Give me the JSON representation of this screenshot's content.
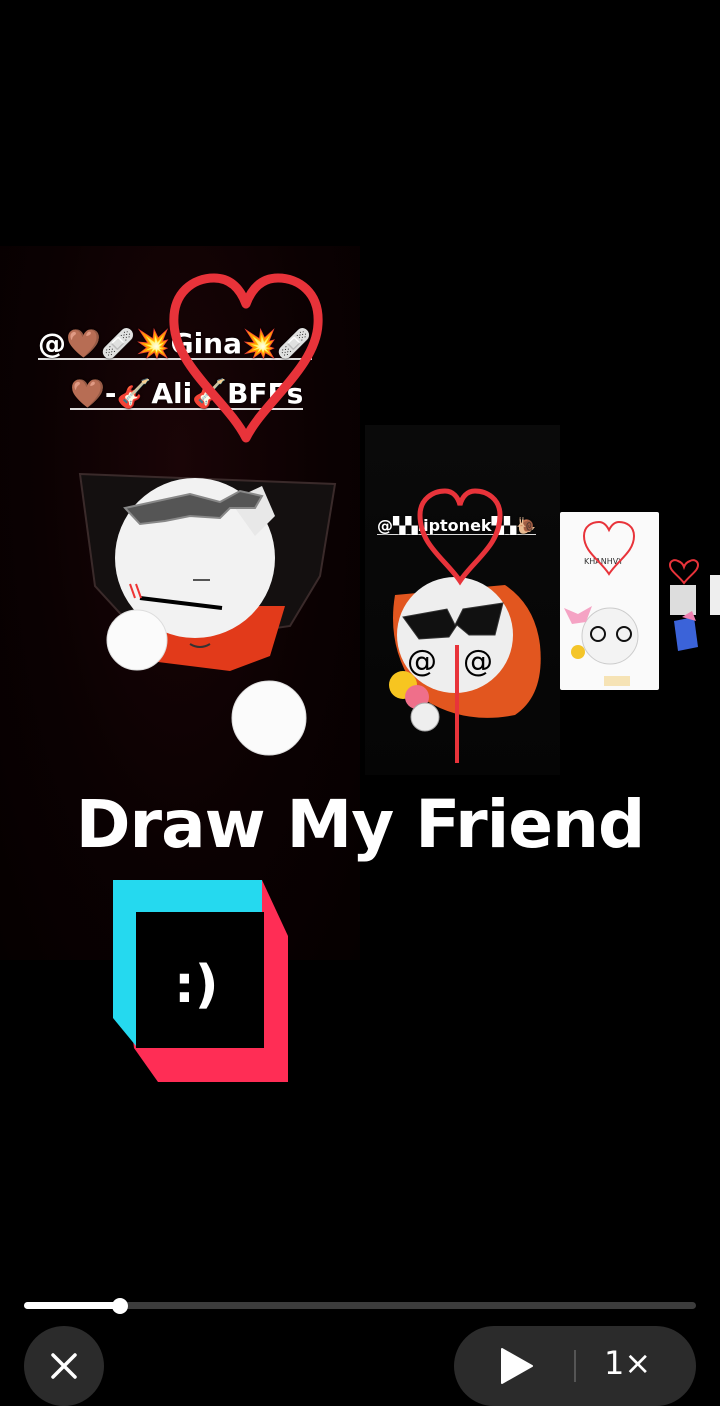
{
  "video": {
    "caption_line1": "@🤎🩹💥Gina💥🩹",
    "caption_line2": "🤎-🎸Ali🎸BFFs",
    "mid_caption": "@▚▚liptonek▚▚🐌",
    "small_caption": "KHANHVY",
    "title": "Draw My Friend",
    "logo_face": ":)"
  },
  "player": {
    "progress": 0.143,
    "speed_label": "1×"
  },
  "icons": {
    "close": "close-icon",
    "play": "play-icon"
  },
  "colors": {
    "heart": "#e8333a",
    "logo_cyan": "#25d9ef",
    "logo_pink": "#ff2d55",
    "control_bg": "#2b2b2b"
  }
}
